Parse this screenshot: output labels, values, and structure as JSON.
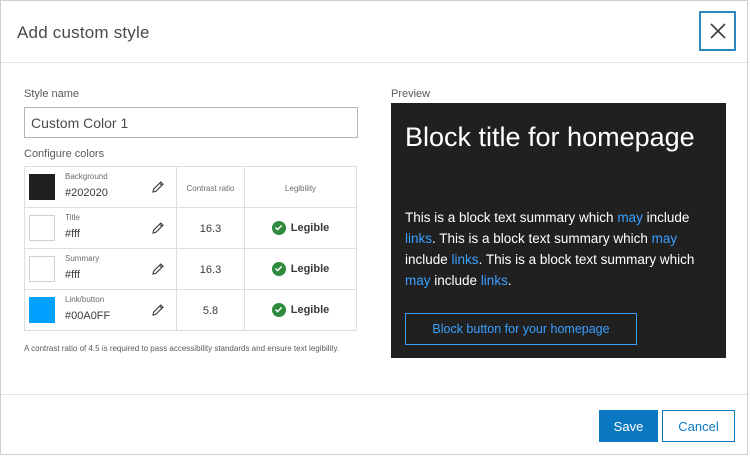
{
  "dialog": {
    "title": "Add custom style",
    "close_icon": "close-icon"
  },
  "style_name": {
    "label": "Style name",
    "value": "Custom Color 1"
  },
  "configure": {
    "label": "Configure colors",
    "headers": {
      "contrast": "Contrast ratio",
      "legibility": "Legibility"
    },
    "rows": [
      {
        "name": "Background",
        "hex": "#202020",
        "color": "#202020",
        "contrast": "",
        "legibility": ""
      },
      {
        "name": "Title",
        "hex": "#fff",
        "color": "#ffffff",
        "contrast": "16.3",
        "legibility": "Legible"
      },
      {
        "name": "Summary",
        "hex": "#fff",
        "color": "#ffffff",
        "contrast": "16.3",
        "legibility": "Legible"
      },
      {
        "name": "Link/button",
        "hex": "#00A0FF",
        "color": "#00a0ff",
        "contrast": "5.8",
        "legibility": "Legible"
      }
    ],
    "note": "A contrast ratio of 4.5 is required to pass accessibility standards and ensure text legibility."
  },
  "preview": {
    "label": "Preview",
    "title": "Block title for homepage",
    "summary_parts": {
      "p1": "This is a block text summary which ",
      "link_may": "may",
      "p2": " include ",
      "link_links": "links",
      "p3": ". This is a block text summary which ",
      "p4": " include ",
      "p5": ". This is a block text summary which ",
      "p6": " include ",
      "p7": "."
    },
    "button": "Block button for your homepage"
  },
  "footer": {
    "save": "Save",
    "cancel": "Cancel"
  },
  "colors": {
    "accent": "#0b79c2",
    "preview_bg": "#202020",
    "preview_link": "#3aa0ff",
    "legible_check": "#2e8b3e"
  }
}
